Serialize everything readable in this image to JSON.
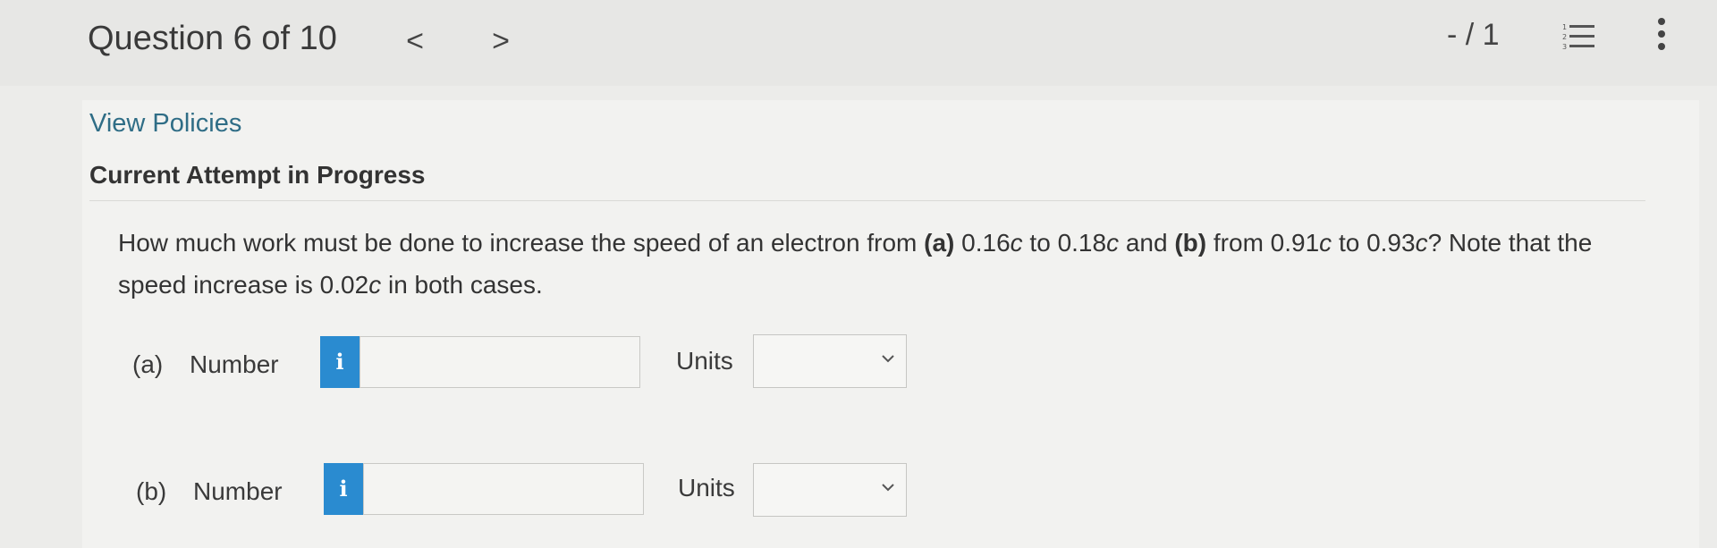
{
  "header": {
    "question_title": "Question 6 of 10",
    "prev_icon": "chevron-left-icon",
    "prev_glyph": "<",
    "next_icon": "chevron-right-icon",
    "next_glyph": ">",
    "score": "- / 1",
    "list_icon": "numbered-list-icon",
    "more_icon": "more-vertical-icon"
  },
  "panel": {
    "view_policies": "View Policies",
    "attempt_status": "Current Attempt in Progress"
  },
  "question": {
    "text_1": "How much work must be done to increase the speed of an electron from ",
    "part_a_marker": "(a)",
    "text_2": " 0.16",
    "c1": "c",
    "text_3": " to 0.18",
    "c2": "c",
    "text_4": " and ",
    "part_b_marker": "(b)",
    "text_5": " from 0.91",
    "c3": "c",
    "text_6": " to 0.93",
    "c4": "c",
    "text_7": "? Note that the speed increase is 0.02",
    "c5": "c",
    "text_8": " in both cases."
  },
  "answers": {
    "a": {
      "label": "(a)",
      "number_label": "Number",
      "info_glyph": "i",
      "number_value": "",
      "units_label": "Units",
      "units_value": ""
    },
    "b": {
      "label": "(b)",
      "number_label": "Number",
      "info_glyph": "i",
      "number_value": "",
      "units_label": "Units",
      "units_value": ""
    }
  },
  "colors": {
    "link": "#2f6d86",
    "info_button": "#2a8bd0"
  }
}
